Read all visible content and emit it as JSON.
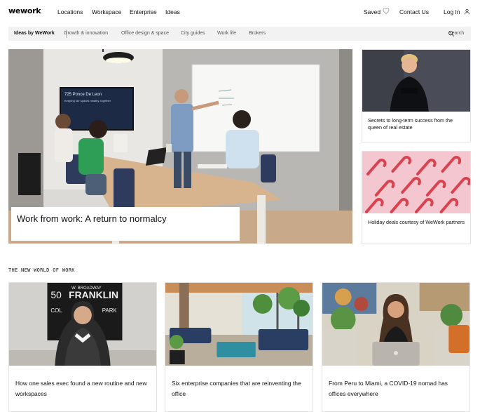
{
  "nav": {
    "logo": "wework",
    "links": [
      "Locations",
      "Workspace",
      "Enterprise",
      "Ideas"
    ],
    "saved": "Saved",
    "contact": "Contact Us",
    "login": "Log In"
  },
  "subnav": {
    "active": "Ideas by WeWork",
    "links": [
      "Growth & innovation",
      "Office design & space",
      "City guides",
      "Work life",
      "Brokers"
    ],
    "search": "Search"
  },
  "hero": {
    "title": "Work from work: A return to normalcy",
    "screen_text": "725 Ponce De Leon",
    "screen_subtext": "Keeping our spaces healthy, together"
  },
  "side_cards": [
    {
      "title": "Secrets to long-term success from the queen of real estate"
    },
    {
      "title": "Holiday deals courtesy of WeWork partners"
    }
  ],
  "section": {
    "heading": "THE NEW WORLD OF WORK"
  },
  "cards": [
    {
      "title": "How one sales exec found a new routine and new workspaces",
      "sign_line1": "W. BROADWAY",
      "sign_line2": "FRANKLIN",
      "sign_line3": "COL",
      "sign_line4": "PARK",
      "sign_number": "50"
    },
    {
      "title": "Six enterprise companies that are reinventing the office"
    },
    {
      "title": "From Peru to Miami, a COVID-19 nomad has offices everywhere"
    }
  ],
  "colors": {
    "brand": "#000000",
    "subnav_bg": "#f2f2f2",
    "card_border": "#e2e2e2",
    "candy_pink": "#f4c6cf",
    "candy_red": "#d8434f"
  },
  "icons": {
    "saved": "heart-icon",
    "login": "user-icon",
    "search": "search-icon"
  }
}
